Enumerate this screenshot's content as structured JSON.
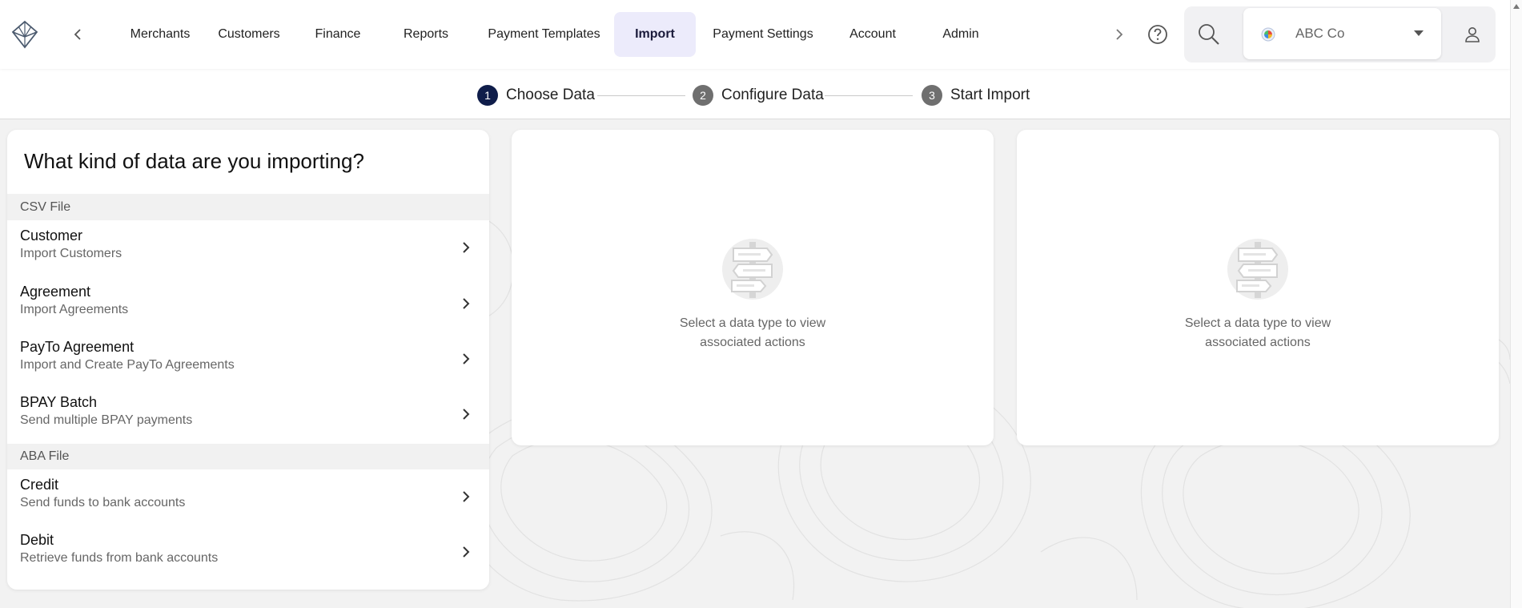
{
  "nav": {
    "items": [
      {
        "label": "Merchants",
        "active": false
      },
      {
        "label": "Customers",
        "active": false
      },
      {
        "label": "Finance",
        "active": false
      },
      {
        "label": "Reports",
        "active": false
      },
      {
        "label": "Payment Templates",
        "active": false
      },
      {
        "label": "Import",
        "active": true
      },
      {
        "label": "Payment Settings",
        "active": false
      },
      {
        "label": "Account",
        "active": false
      },
      {
        "label": "Admin",
        "active": false
      }
    ],
    "accent_color": "#ecebfb"
  },
  "org_selector": {
    "name": "ABC Co"
  },
  "stepper": {
    "steps": [
      {
        "number": "1",
        "label": "Choose Data",
        "active": true
      },
      {
        "number": "2",
        "label": "Configure Data",
        "active": false
      },
      {
        "number": "3",
        "label": "Start Import",
        "active": false
      }
    ]
  },
  "left_panel": {
    "title": "What kind of data are you importing?",
    "sections": [
      {
        "header": "CSV File",
        "items": [
          {
            "title": "Customer",
            "subtitle": "Import Customers"
          },
          {
            "title": "Agreement",
            "subtitle": "Import Agreements"
          },
          {
            "title": "PayTo Agreement",
            "subtitle": "Import and Create PayTo Agreements"
          },
          {
            "title": "BPAY Batch",
            "subtitle": "Send multiple BPAY payments"
          }
        ]
      },
      {
        "header": "ABA File",
        "items": [
          {
            "title": "Credit",
            "subtitle": "Send funds to bank accounts"
          },
          {
            "title": "Debit",
            "subtitle": "Retrieve funds from bank accounts"
          }
        ]
      }
    ]
  },
  "empty_panels": [
    {
      "line1": "Select a data type to view",
      "line2": "associated actions"
    },
    {
      "line1": "Select a data type to view",
      "line2": "associated actions"
    }
  ]
}
